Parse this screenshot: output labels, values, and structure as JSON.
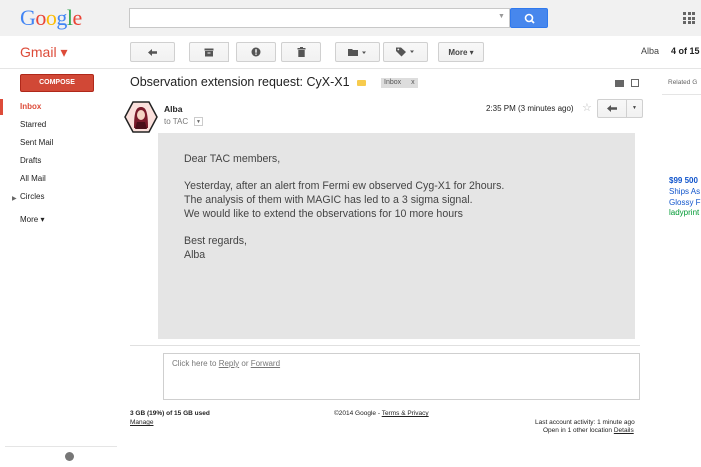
{
  "header": {
    "logo_text": "Google",
    "logo_letters": [
      "G",
      "o",
      "o",
      "g",
      "l",
      "e"
    ],
    "logo_colors": [
      "#4285f4",
      "#ea4335",
      "#fbbc05",
      "#4285f4",
      "#34a853",
      "#ea4335"
    ],
    "search_placeholder": "",
    "search_button_icon": "search-icon",
    "apps_icon": "apps-grid-icon"
  },
  "toolbar": {
    "gmail_label": "Gmail ▾",
    "buttons": [
      "back-arrow-icon",
      "archive-icon",
      "report-spam-icon",
      "delete-icon",
      "folder-icon",
      "label-icon"
    ],
    "more_label": "More ▾",
    "account_name": "Alba",
    "page_count_label": "4 of 15"
  },
  "sidebar": {
    "compose_label": "COMPOSE",
    "items": [
      {
        "label": "Inbox",
        "active": true
      },
      {
        "label": "Starred"
      },
      {
        "label": "Sent Mail"
      },
      {
        "label": "Drafts"
      },
      {
        "label": "All Mail"
      },
      {
        "label": "Circles"
      },
      {
        "label": "More ▾"
      }
    ],
    "hangouts_icon": "hangouts-icon"
  },
  "message": {
    "subject": "Observation extension request: CyX-X1",
    "label_chip": "Inbox",
    "label_chip_close": "x",
    "sender": "Alba",
    "recipient": "to TAC",
    "timestamp": "2:35 PM (3 minutes ago)",
    "body_lines": [
      "Dear TAC members,",
      "",
      "Yesterday, after an alert from Fermi ew observed Cyg-X1 for 2hours.",
      "The analysis of them with MAGIC has led to a 3 sigma signal.",
      "We would like to extend the observations for 10 more hours",
      "",
      "Best regards,",
      "Alba"
    ]
  },
  "reply_box": {
    "prefix": "Click here to ",
    "reply_link": "Reply",
    "middle": " or ",
    "forward_link": "Forward"
  },
  "footer": {
    "storage": "3 GB (19%) of 15 GB used",
    "manage_link": "Manage",
    "copyright": "©2014 Google - ",
    "terms_link": "Terms & Privacy",
    "last_activity": "Last account activity: 1 minute ago",
    "open_location": "Open in 1 other location ",
    "details_link": "Details"
  },
  "ads": {
    "related_label": "Related G",
    "price": "$99 500",
    "line1": "Ships As",
    "line2": "Glossy F",
    "line3": "ladyprint"
  },
  "colors": {
    "accent_red": "#dd4b39",
    "compose_red": "#d14836",
    "search_blue": "#4787ed",
    "body_bg": "#e5e5e5",
    "link_blue": "#15c",
    "ad_green": "#093"
  }
}
